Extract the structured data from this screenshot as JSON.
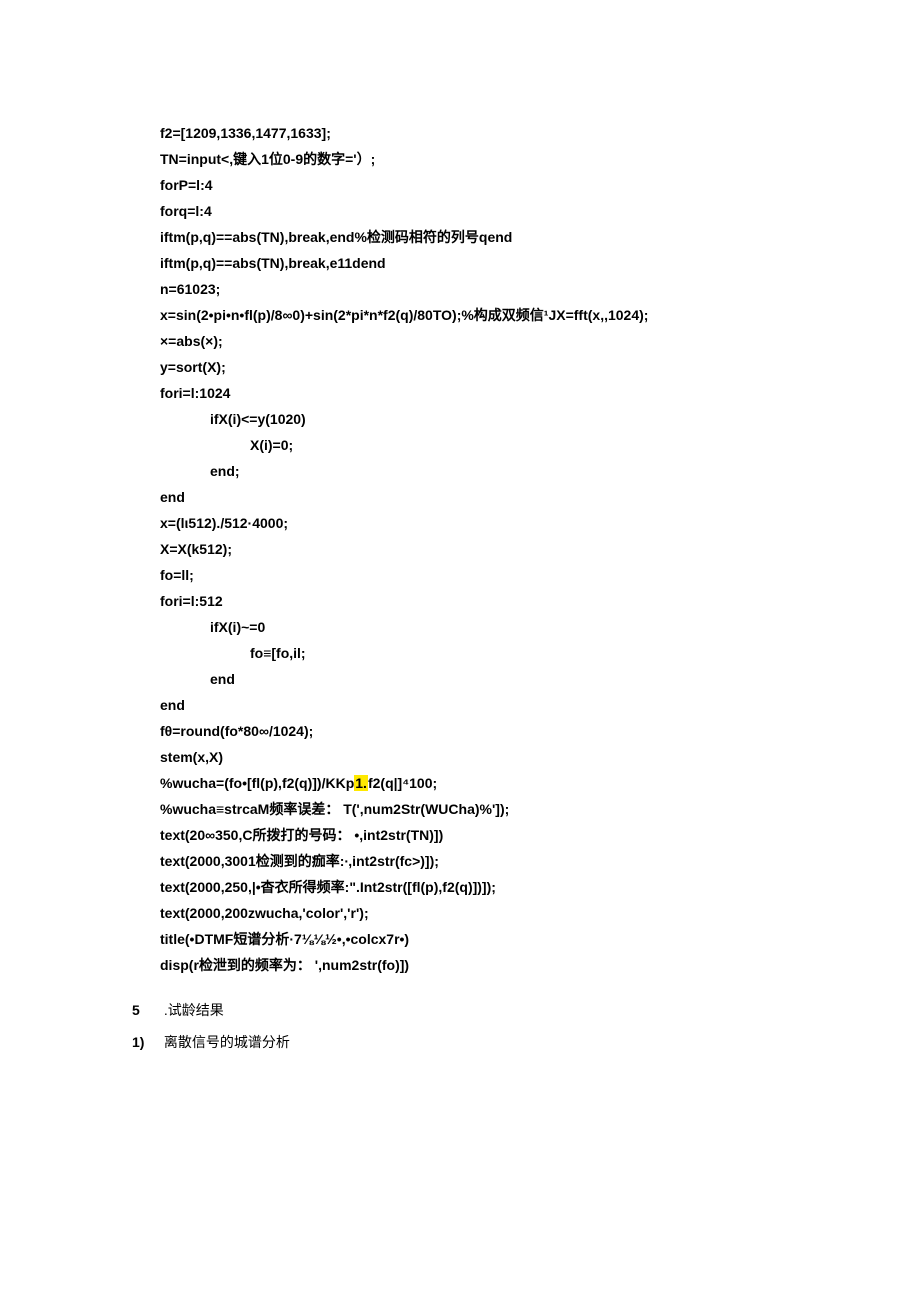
{
  "code": {
    "l1": "f2=[1209,1336,1477,1633];",
    "l2": "TN=input<,键入1位0-9的数字='）;",
    "l3": "forP=l:4",
    "l4": "forq=l:4",
    "l5": "iftm(p,q)==abs(TN),break,end%检测码相符的列号qend",
    "l6": "iftm(p,q)==abs(TN),break,e11dend",
    "l7": "n=61023;",
    "l8": "x=sin(2•pi•n•fl(p)/8∞0)+sin(2*pi*n*f2(q)/80TO);%构成双频信¹JX=fft(x,,1024);",
    "l9": "×=abs(×);",
    "l10": "y=sort(X);",
    "l11": "fori=l:1024",
    "l12": "ifX(i)<=y(1020)",
    "l13": "X(i)=0;",
    "l14": "end;",
    "l15": "end",
    "l16": "x=(lι512)./512·4000;",
    "l17": "X=X(k512);",
    "l18": "fo=ll;",
    "l19": "fori=l:512",
    "l20": "ifX(i)~=0",
    "l21": "fo≡[fo,il;",
    "l22": "end",
    "l23": "end",
    "l24": "fθ=round(fo*80∞/1024);",
    "l25": "stem(x,X)",
    "l26a": "%wucha=(fo•[fl(p),f2(q)])/KKp",
    "l26hl": "1.",
    "l26b": "f2(q|]⁴100;",
    "l27": "%wucha≡strcaM频率误差： T(',num2Str(WUCha)%']);",
    "l28": "text(20∞350,C所拨打的号码： •,int2str(TN)])",
    "l29": "text(2000,3001检测到的痂率:∙,int2str(fc>)]);",
    "l30": "text(2000,250,|•杳衣所得频率:\".Int2str([fl(p),f2(q)])]);",
    "l31": "text(2000,200zwucha,'color','r');",
    "l32": "title(•DTMF短谱分析·7⅛⅛½•,•colcx7r•)",
    "l33": "disp(r检泄到的频率为： ',num2str(fo)])"
  },
  "sections": {
    "s1num": "5",
    "s1text": " .试龄结果",
    "s2num": "1)",
    "s2text": " 离散信号的城谱分析"
  }
}
